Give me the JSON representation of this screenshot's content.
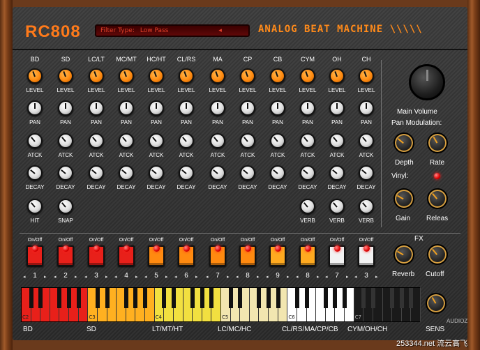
{
  "app": {
    "logo": "RC808",
    "title": "ANALOG BEAT MACHINE \\\\\\\\\\",
    "filter": {
      "label": "Filter Type:",
      "value": "Low Pass",
      "arrow": "◂"
    }
  },
  "channels": [
    {
      "name": "BD",
      "pad_color": "#e8201a",
      "pad_num": "1"
    },
    {
      "name": "SD",
      "pad_color": "#e8201a",
      "pad_num": "2"
    },
    {
      "name": "LC/LT",
      "pad_color": "#e8201a",
      "pad_num": "3"
    },
    {
      "name": "MC/MT",
      "pad_color": "#e8201a",
      "pad_num": "4"
    },
    {
      "name": "HC/HT",
      "pad_color": "#ff8a10",
      "pad_num": "5"
    },
    {
      "name": "CL/RS",
      "pad_color": "#ff8a10",
      "pad_num": "6"
    },
    {
      "name": "MA",
      "pad_color": "#ff8a10",
      "pad_num": "7"
    },
    {
      "name": "CP",
      "pad_color": "#ff8a10",
      "pad_num": "8"
    },
    {
      "name": "CB",
      "pad_color": "#ffaa20",
      "pad_num": "9"
    },
    {
      "name": "CYM",
      "pad_color": "#ffaa20",
      "pad_num": "8"
    },
    {
      "name": "OH",
      "pad_color": "#f2f2f2",
      "pad_num": "7"
    },
    {
      "name": "CH",
      "pad_color": "#f2f2f2",
      "pad_num": "3"
    }
  ],
  "knob_labels": {
    "level": "LEVEL",
    "pan": "PAN",
    "atck": "ATCK",
    "decay": "DECAY",
    "hit": "HIT",
    "snap": "SNAP",
    "verb": "VERB"
  },
  "onoff": "On/Off",
  "right_panel": {
    "main_volume": "Main Volume",
    "pan_mod": "Pan Modulation:",
    "depth": "Depth",
    "rate": "Rate",
    "vinyl": "Vinyl:",
    "gain": "Gain",
    "releas": "Releas",
    "fx": "FX",
    "reverb": "Reverb",
    "cutoff": "Cutoff",
    "sens": "SENS"
  },
  "keyboard": {
    "octaves": [
      "C2",
      "C3",
      "C4",
      "C5",
      "C6",
      "C7"
    ],
    "octave_colors": [
      "#e8201a",
      "#ffb020",
      "#f2e040",
      "#f2e6b0",
      "#ffffff",
      "#1a1a1a"
    ],
    "groups": [
      "BD",
      "SD",
      "LT/MT/HT",
      "LC/MC/HC",
      "CL/RS/MA/CP/CB",
      "CYM/OH/CH"
    ]
  },
  "watermark": "253344.net 流云高飞",
  "audioz": "AUDIOZ"
}
